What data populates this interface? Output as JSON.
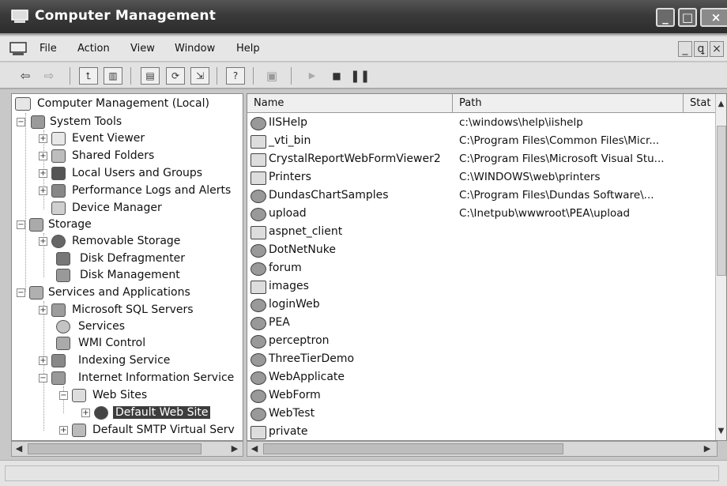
{
  "window": {
    "title": "Computer Management",
    "min": "_",
    "max": "□",
    "close": "×"
  },
  "menu": [
    "File",
    "Action",
    "View",
    "Window",
    "Help"
  ],
  "mdi": {
    "min": "_",
    "restore": "ꝗ",
    "close": "×"
  },
  "toolbar": [
    "back-arrow",
    "forward-arrow",
    "up-folder",
    "show-hide-tree",
    "properties",
    "refresh",
    "export-list",
    "help",
    "computer",
    "start",
    "stop",
    "pause"
  ],
  "tree": {
    "root": "Computer Management (Local)",
    "system_tools": "System Tools",
    "event_viewer": "Event Viewer",
    "shared_folders": "Shared Folders",
    "local_users": "Local Users and Groups",
    "perf_logs": "Performance Logs and Alerts",
    "device_manager": "Device Manager",
    "storage": "Storage",
    "removable_storage": "Removable Storage",
    "disk_defrag": "Disk Defragmenter",
    "disk_mgmt": "Disk Management",
    "services_apps": "Services and Applications",
    "sql_servers": "Microsoft SQL Servers",
    "services": "Services",
    "wmi": "WMI Control",
    "indexing": "Indexing Service",
    "iis": "Internet Information Service",
    "web_sites": "Web Sites",
    "default_web_site": "Default Web Site",
    "smtp": "Default SMTP Virtual Serv"
  },
  "list": {
    "columns": [
      "Name",
      "Path",
      "Stat"
    ],
    "rows": [
      {
        "name": "IISHelp",
        "path": "c:\\windows\\help\\iishelp",
        "icon": "web"
      },
      {
        "name": "_vti_bin",
        "path": "C:\\Program Files\\Common Files\\Micr...",
        "icon": "folder"
      },
      {
        "name": "CrystalReportWebFormViewer2",
        "path": "C:\\Program Files\\Microsoft Visual Stu...",
        "icon": "folder"
      },
      {
        "name": "Printers",
        "path": "C:\\WINDOWS\\web\\printers",
        "icon": "folder"
      },
      {
        "name": "DundasChartSamples",
        "path": "C:\\Program Files\\Dundas Software\\...",
        "icon": "web"
      },
      {
        "name": "upload",
        "path": "C:\\Inetpub\\wwwroot\\PEA\\upload",
        "icon": "web"
      },
      {
        "name": "aspnet_client",
        "path": "",
        "icon": "folder"
      },
      {
        "name": "DotNetNuke",
        "path": "",
        "icon": "web"
      },
      {
        "name": "forum",
        "path": "",
        "icon": "web"
      },
      {
        "name": "images",
        "path": "",
        "icon": "folder"
      },
      {
        "name": "loginWeb",
        "path": "",
        "icon": "web"
      },
      {
        "name": "PEA",
        "path": "",
        "icon": "web"
      },
      {
        "name": "perceptron",
        "path": "",
        "icon": "web"
      },
      {
        "name": "ThreeTierDemo",
        "path": "",
        "icon": "web"
      },
      {
        "name": "WebApplicate",
        "path": "",
        "icon": "web"
      },
      {
        "name": "WebForm",
        "path": "",
        "icon": "web"
      },
      {
        "name": "WebTest",
        "path": "",
        "icon": "web"
      },
      {
        "name": "private",
        "path": "",
        "icon": "folder"
      }
    ]
  }
}
